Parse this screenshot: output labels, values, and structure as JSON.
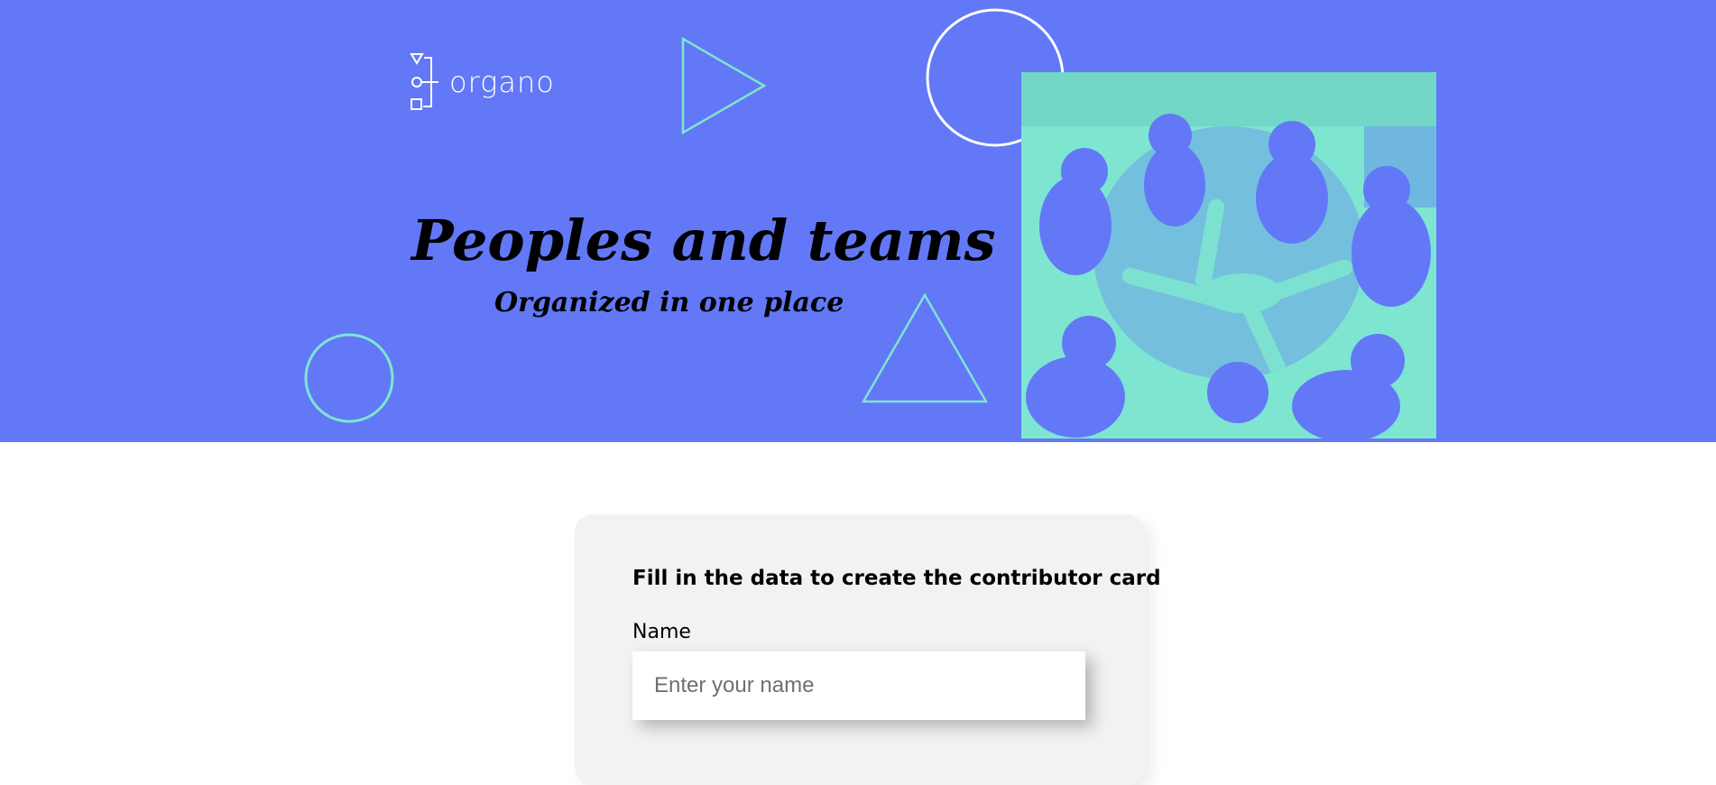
{
  "brand": {
    "name": "organo",
    "icon": "org-chart-icon"
  },
  "hero": {
    "title": "Peoples and teams",
    "subtitle": "Organized in one place",
    "image": "team-hands-together-photo"
  },
  "form": {
    "heading": "Fill in the data to create the contributor card",
    "fields": [
      {
        "label": "Name",
        "placeholder": "Enter your name",
        "value": ""
      }
    ]
  },
  "colors": {
    "banner": "#6278F7",
    "accent": "#7EE5D0",
    "card": "#F2F2F2"
  }
}
